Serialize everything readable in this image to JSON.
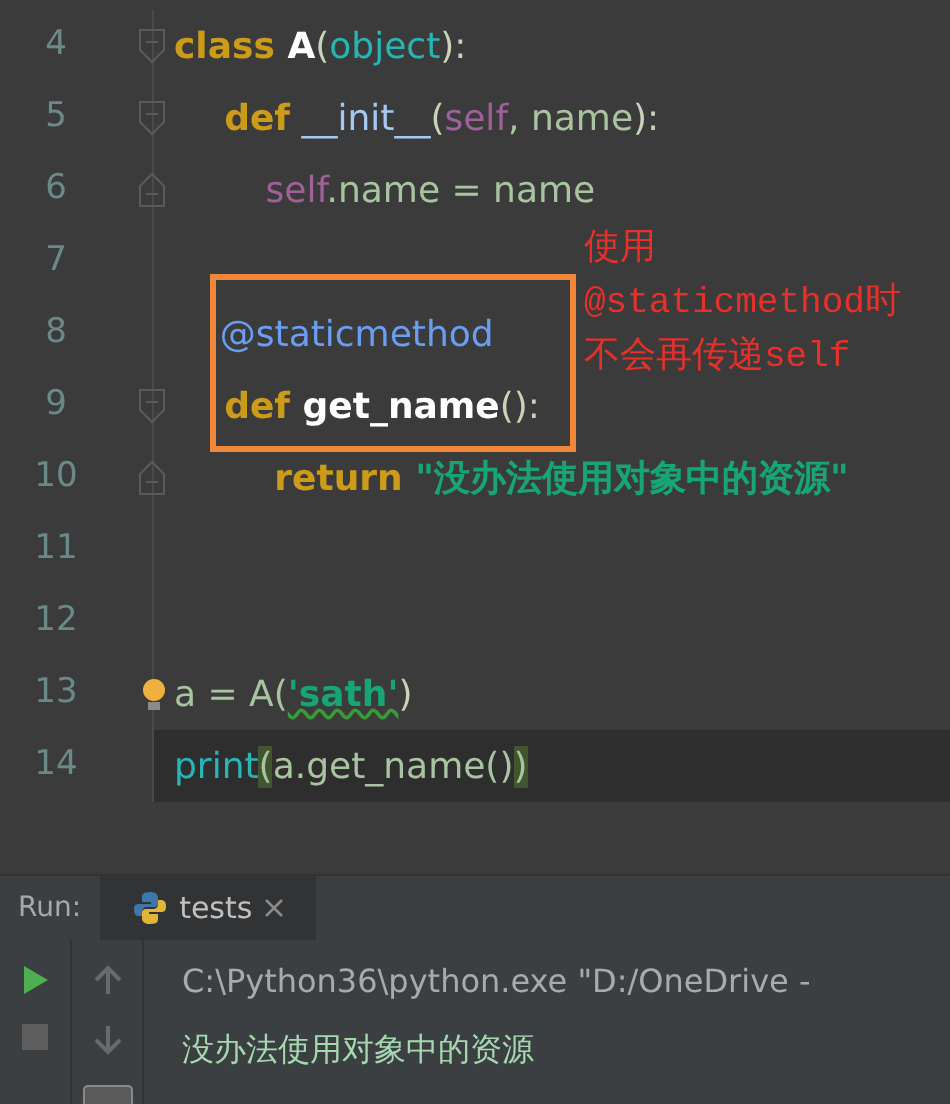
{
  "editor": {
    "lines": [
      {
        "number": "4",
        "fold_open": true,
        "fold_end": false,
        "current": false,
        "bulb": false,
        "tokens": [
          {
            "text": "class",
            "kind": "keyword"
          },
          {
            "text": " A",
            "kind": "classname"
          },
          {
            "text": "(",
            "kind": "punct"
          },
          {
            "text": "object",
            "kind": "builtin"
          },
          {
            "text": "):",
            "kind": "punct"
          }
        ]
      },
      {
        "number": "5",
        "fold_open": true,
        "fold_end": false,
        "current": false,
        "bulb": false,
        "tokens": [
          {
            "text": "    def",
            "kind": "keyword"
          },
          {
            "text": " __init__",
            "kind": "magic"
          },
          {
            "text": "(",
            "kind": "punct"
          },
          {
            "text": "self",
            "kind": "self"
          },
          {
            "text": ", name",
            "kind": "plain"
          },
          {
            "text": "):",
            "kind": "punct"
          }
        ]
      },
      {
        "number": "6",
        "fold_open": false,
        "fold_end": true,
        "current": false,
        "bulb": false,
        "tokens": [
          {
            "text": "        self",
            "kind": "self"
          },
          {
            "text": ".name = name",
            "kind": "plain"
          }
        ]
      },
      {
        "number": "7",
        "fold_open": false,
        "fold_end": false,
        "current": false,
        "bulb": false
      },
      {
        "number": "8",
        "fold_open": false,
        "fold_end": false,
        "current": false,
        "bulb": false,
        "tokens": [
          {
            "text": "    @staticmethod",
            "kind": "decorator"
          }
        ]
      },
      {
        "number": "9",
        "fold_open": true,
        "fold_end": false,
        "current": false,
        "bulb": false,
        "tokens": [
          {
            "text": "    def",
            "kind": "keyword"
          },
          {
            "text": " get_name",
            "kind": "funcname"
          },
          {
            "text": "():",
            "kind": "punct"
          }
        ]
      },
      {
        "number": "10",
        "fold_open": false,
        "fold_end": true,
        "current": false,
        "bulb": false,
        "tokens": [
          {
            "text": "        return",
            "kind": "keyword"
          },
          {
            "text": " \"没办法使用对象中的资源\"",
            "kind": "string"
          }
        ]
      },
      {
        "number": "11",
        "fold_open": false,
        "fold_end": false,
        "current": false,
        "bulb": false
      },
      {
        "number": "12",
        "fold_open": false,
        "fold_end": false,
        "current": false,
        "bulb": false
      },
      {
        "number": "13",
        "fold_open": false,
        "fold_end": false,
        "current": false,
        "bulb": true,
        "tokens": [
          {
            "text": "a = A(",
            "kind": "plain"
          },
          {
            "text": "'sath'",
            "kind": "typo-string"
          },
          {
            "text": ")",
            "kind": "punct"
          }
        ]
      },
      {
        "number": "14",
        "fold_open": false,
        "fold_end": false,
        "current": true,
        "bulb": false,
        "tokens": [
          {
            "text": "print",
            "kind": "builtin"
          },
          {
            "text": "(",
            "kind": "bracket-match"
          },
          {
            "text": "a.get_name()",
            "kind": "plain"
          },
          {
            "text": ")",
            "kind": "bracket-match"
          }
        ]
      }
    ],
    "annotation": {
      "lines": [
        "使用",
        "@staticmethod时",
        "不会再传递self"
      ]
    }
  },
  "run_panel": {
    "label": "Run:",
    "tabs": [
      {
        "label": "tests",
        "selected": true
      }
    ],
    "console": [
      {
        "text": "C:\\Python36\\python.exe \"D:/OneDrive -",
        "kind": "command"
      },
      {
        "text": "没办法使用对象中的资源",
        "kind": "output"
      }
    ]
  }
}
